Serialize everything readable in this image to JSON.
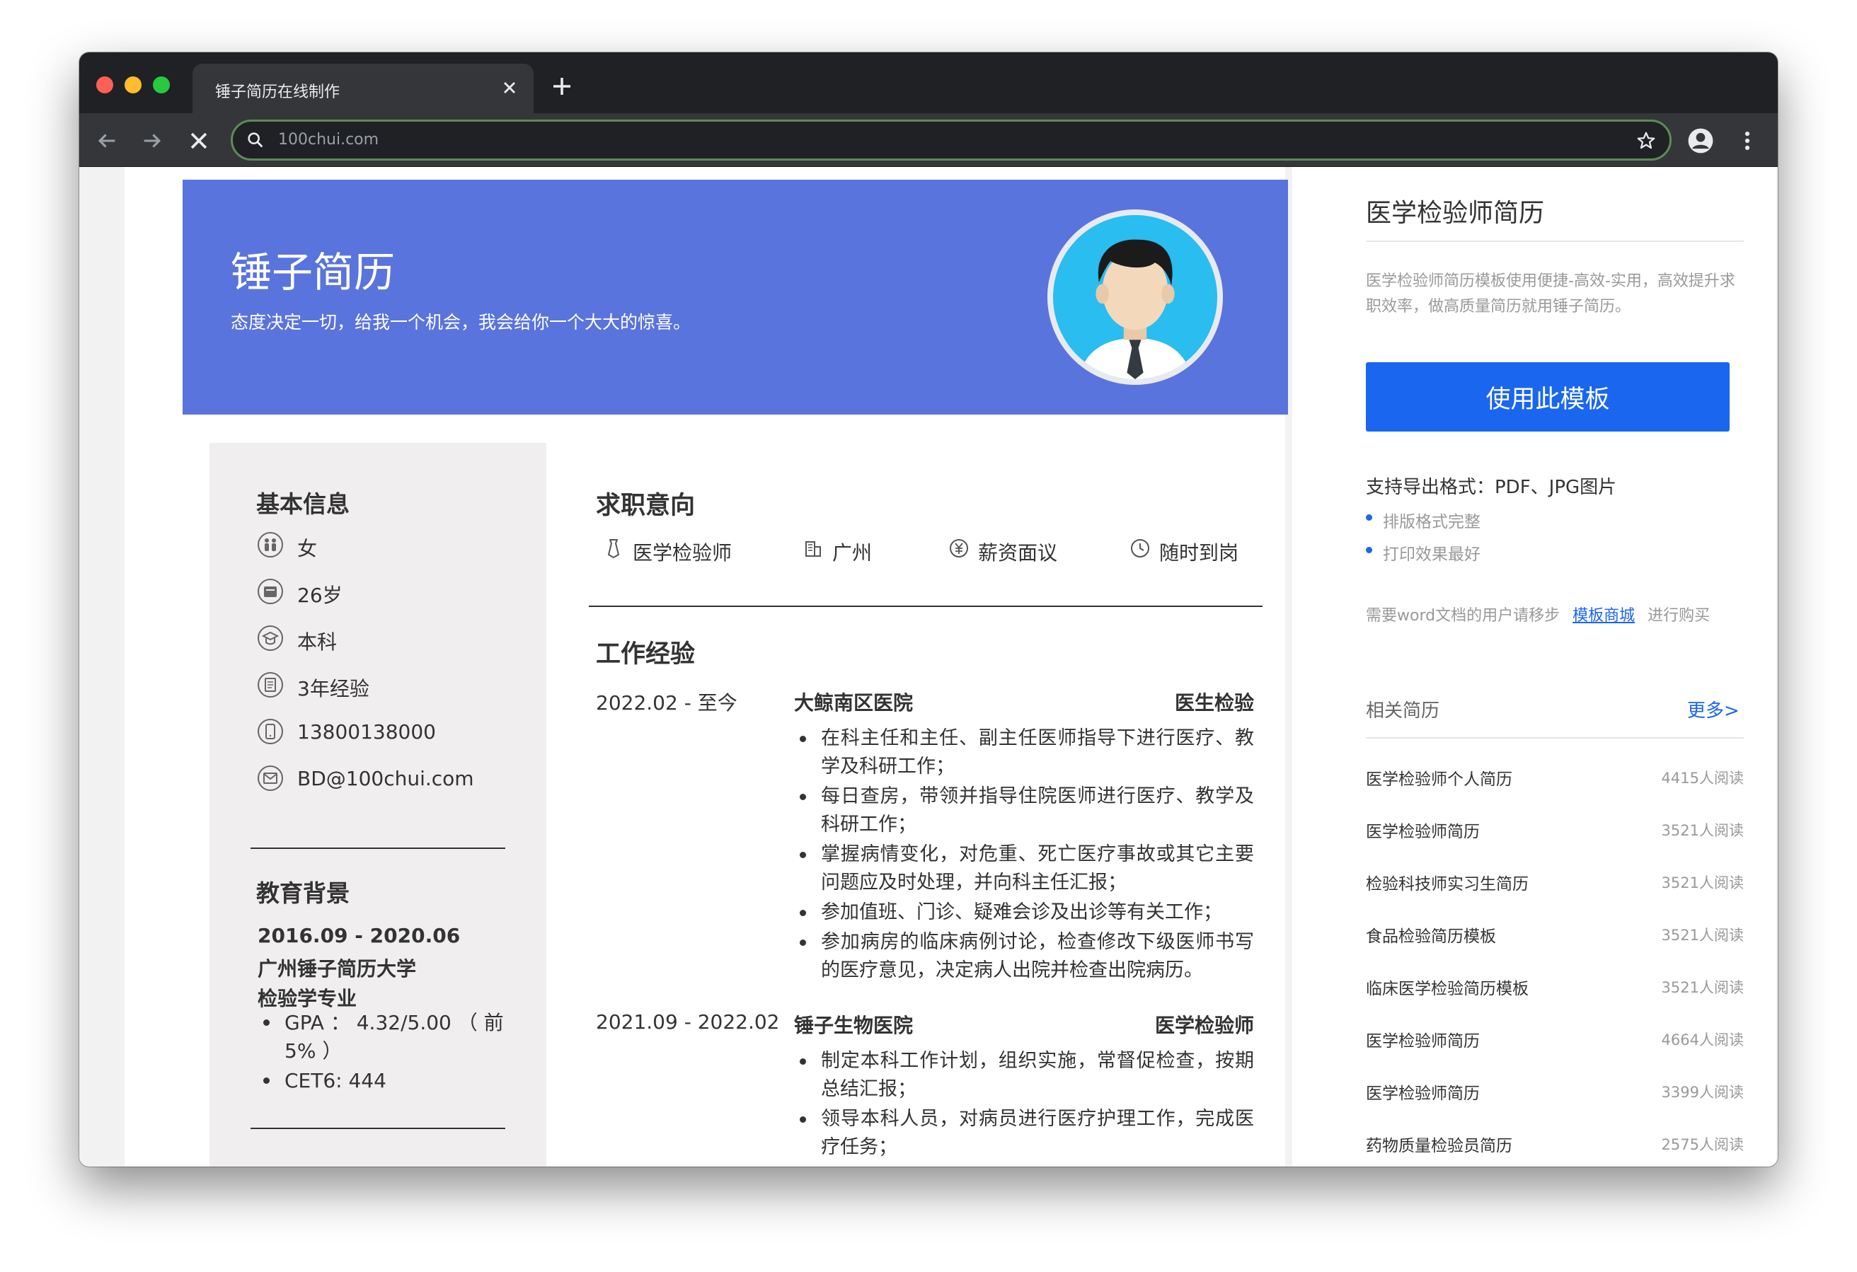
{
  "browser": {
    "tab_title": "锤子简历在线制作",
    "url": "100chui.com"
  },
  "resume": {
    "hero_title": "锤子简历",
    "hero_subtitle": "态度决定一切，给我一个机会，我会给你一个大大的惊喜。",
    "basic_info_title": "基本信息",
    "basic_info": [
      {
        "icon": "gender-icon",
        "text": "女"
      },
      {
        "icon": "age-icon",
        "text": "26岁"
      },
      {
        "icon": "degree-icon",
        "text": "本科"
      },
      {
        "icon": "experience-icon",
        "text": "3年经验"
      },
      {
        "icon": "phone-icon",
        "text": "13800138000"
      },
      {
        "icon": "email-icon",
        "text": "BD@100chui.com"
      }
    ],
    "education_title": "教育背景",
    "education": {
      "period": "2016.09 - 2020.06",
      "school": "广州锤子简历大学",
      "major": "检验学专业",
      "gpa_line1": "GPA ： 4.32/5.00 （ 前",
      "gpa_line2": "5% ）",
      "cet": "CET6: 444"
    },
    "intent_title": "求职意向",
    "intent": [
      {
        "icon": "position-icon",
        "text": "医学检验师"
      },
      {
        "icon": "city-icon",
        "text": "广州"
      },
      {
        "icon": "salary-icon",
        "text": "薪资面议"
      },
      {
        "icon": "clock-icon",
        "text": "随时到岗"
      }
    ],
    "work_title": "工作经验",
    "jobs": [
      {
        "period": "2022.02 - 至今",
        "company": "大鲸南区医院",
        "role": "医生检验",
        "duties": [
          "在科主任和主任、副主任医师指导下进行医疗、教学及科研工作；",
          "每日查房，带领并指导住院医师进行医疗、教学及科研工作；",
          "掌握病情变化，对危重、死亡医疗事故或其它主要问题应及时处理，并向科主任汇报；",
          "参加值班、门诊、疑难会诊及出诊等有关工作；",
          "参加病房的临床病例讨论，检查修改下级医师书写的医疗意见，决定病人出院并检查出院病历。"
        ]
      },
      {
        "period": "2021.09 - 2022.02",
        "company": "锤子生物医院",
        "role": "医学检验师",
        "duties": [
          "制定本科工作计划，组织实施，常督促检查，按期总结汇报；",
          "领导本科人员，对病员进行医疗护理工作，完成医疗任务；"
        ]
      }
    ]
  },
  "sidebar": {
    "title": "医学检验师简历",
    "description": "医学检验师简历模板使用便捷-高效-实用，高效提升求职效率，做高质量简历就用锤子简历。",
    "use_button": "使用此模板",
    "export_title": "支持导出格式：PDF、JPG图片",
    "export_items": [
      "排版格式完整",
      "打印效果最好"
    ],
    "word_note_pre": "需要word文档的用户请移步",
    "word_note_link": "模板商城",
    "word_note_post": "进行购买",
    "related_title": "相关简历",
    "related_more": "更多>",
    "related": [
      {
        "name": "医学检验师个人简历",
        "count": "4415人阅读"
      },
      {
        "name": "医学检验师简历",
        "count": "3521人阅读"
      },
      {
        "name": "检验科技师实习生简历",
        "count": "3521人阅读"
      },
      {
        "name": "食品检验简历模板",
        "count": "3521人阅读"
      },
      {
        "name": "临床医学检验简历模板",
        "count": "3521人阅读"
      },
      {
        "name": "医学检验师简历",
        "count": "4664人阅读"
      },
      {
        "name": "医学检验师简历",
        "count": "3399人阅读"
      },
      {
        "name": "药物质量检验员简历",
        "count": "2575人阅读"
      }
    ]
  }
}
